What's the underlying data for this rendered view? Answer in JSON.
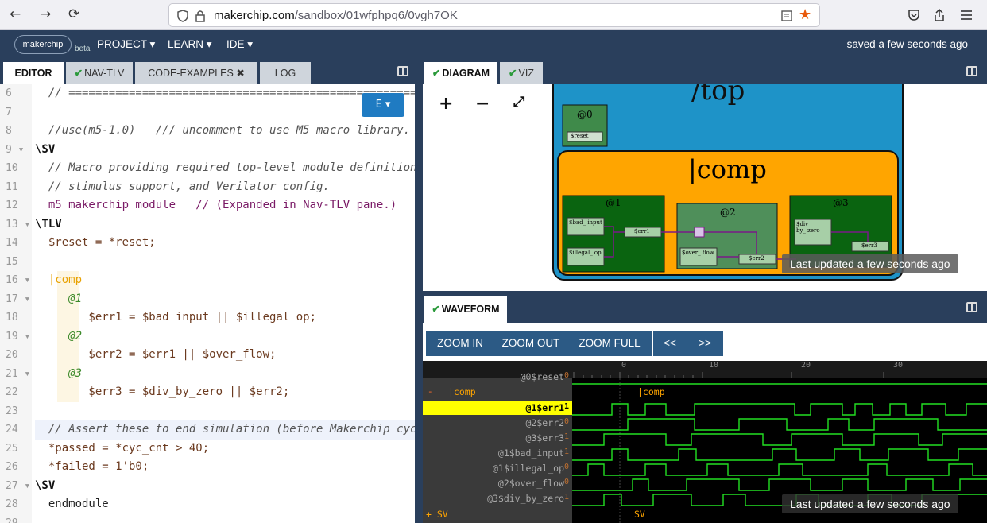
{
  "browser": {
    "back": "←",
    "forward": "→",
    "reload": "⟳",
    "url_domain": "makerchip.com",
    "url_path": "/sandbox/01wfphpq6/0vgh7OK"
  },
  "menubar": {
    "logo": "makerchip",
    "beta": "beta",
    "project": "PROJECT ▾",
    "learn": "LEARN ▾",
    "ide": "IDE ▾",
    "saved": "saved a few seconds ago"
  },
  "editor": {
    "tabs": [
      "EDITOR",
      "NAV-TLV",
      "CODE-EXAMPLES ✖",
      "LOG"
    ],
    "e_button": "E ▾",
    "lines": [
      {
        "n": "6",
        "t": "  // ======================================================="
      },
      {
        "n": "7",
        "t": ""
      },
      {
        "n": "8",
        "t": "  //use(m5-1.0)   /// uncomment to use M5 macro library."
      },
      {
        "n": "9 ▾",
        "t": "\\SV"
      },
      {
        "n": "10",
        "t": "  // Macro providing required top-level module definition, random"
      },
      {
        "n": "11",
        "t": "  // stimulus support, and Verilator config."
      },
      {
        "n": "12",
        "t": "  m5_makerchip_module   // (Expanded in Nav-TLV pane.)"
      },
      {
        "n": "13 ▾",
        "t": "\\TLV"
      },
      {
        "n": "14",
        "t": "  $reset = *reset;"
      },
      {
        "n": "15",
        "t": ""
      },
      {
        "n": "16 ▾",
        "t": "  |comp"
      },
      {
        "n": "17 ▾",
        "t": "     @1"
      },
      {
        "n": "18",
        "t": "        $err1 = $bad_input || $illegal_op;"
      },
      {
        "n": "19 ▾",
        "t": "     @2"
      },
      {
        "n": "20",
        "t": "        $err2 = $err1 || $over_flow;"
      },
      {
        "n": "21 ▾",
        "t": "     @3"
      },
      {
        "n": "22",
        "t": "        $err3 = $div_by_zero || $err2;"
      },
      {
        "n": "23",
        "t": ""
      },
      {
        "n": "24",
        "t": "  // Assert these to end simulation (before Makerchip cycle limit)."
      },
      {
        "n": "25",
        "t": "  *passed = *cyc_cnt > 40;"
      },
      {
        "n": "26",
        "t": "  *failed = 1'b0;"
      },
      {
        "n": "27 ▾",
        "t": "\\SV"
      },
      {
        "n": "28",
        "t": "  endmodule"
      },
      {
        "n": "29",
        "t": ""
      }
    ]
  },
  "diagram": {
    "tabs": [
      "DIAGRAM",
      "VIZ"
    ],
    "zoom_in": "+",
    "zoom_out": "−",
    "fit": "⤢",
    "top_label": "/top",
    "stage0": "@0",
    "reset": "$reset",
    "pipe": "|comp",
    "s1": "@1",
    "s2": "@2",
    "s3": "@3",
    "bad_input": "$bad_ input",
    "illegal_op": "$illegal_ op",
    "err1": "$err1",
    "over_flow": "$over_ flow",
    "err2": "$err2",
    "div_by_zero": "$div_ by_ zero",
    "err3": "$err3",
    "toast": "Last updated a few seconds ago"
  },
  "waveform": {
    "tab": "WAVEFORM",
    "buttons": [
      "ZOOM IN",
      "ZOOM OUT",
      "ZOOM FULL",
      "<<",
      ">>"
    ],
    "ticks": [
      "0",
      "10",
      "20",
      "30"
    ],
    "signals": [
      {
        "name": "@0$reset",
        "val": "0"
      },
      {
        "name": "|comp",
        "val": ""
      },
      {
        "name": "@1$err1",
        "val": "1"
      },
      {
        "name": "@2$err2",
        "val": "0"
      },
      {
        "name": "@3$err3",
        "val": "1"
      },
      {
        "name": "@1$bad_input",
        "val": "1"
      },
      {
        "name": "@1$illegal_op",
        "val": "0"
      },
      {
        "name": "@2$over_flow",
        "val": "0"
      },
      {
        "name": "@3$div_by_zero",
        "val": "1"
      }
    ],
    "scope_comp": "|comp",
    "scope_sv": "SV",
    "sv_left": "+ SV",
    "minus": "-",
    "toast": "Last updated a few seconds ago"
  },
  "colors": {
    "navy": "#2a3f5c",
    "accent_orange": "#e8a100",
    "wave_green": "#22e022",
    "highlight": "#ffff00"
  }
}
